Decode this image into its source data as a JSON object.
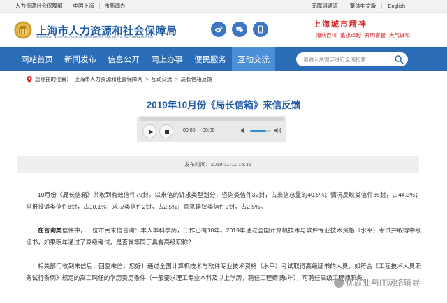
{
  "topbar": {
    "left_links": [
      "人力资源社会保障部",
      "中国上海",
      "市新闻办"
    ],
    "right_links": [
      "无障碍通道",
      "繁体中文版",
      "English"
    ]
  },
  "header": {
    "org_name_cn": "上海市人力资源和社会保障局",
    "org_name_en": "SHANGHAI MUNICIPAL HUMAN RESOURCES AND SOCIAL SECURITY BUREAU",
    "social_icons": [
      "weibo-icon",
      "wechat-icon",
      "mobile-icon"
    ],
    "spirit_title": "上海城市精神",
    "spirit_words": [
      "海纳百川",
      "追求卓越",
      "开明睿智",
      "大气谦和"
    ]
  },
  "nav": {
    "items": [
      "网站首页",
      "新闻发布",
      "信息公开",
      "网上办事",
      "便民服务",
      "互动交流"
    ],
    "active_index": 5,
    "search_placeholder": "请输入关键字进行全网检索"
  },
  "breadcrumb": {
    "prefix": "您现在的位置：",
    "items": [
      "上海市人力资源和社会保障网",
      "互动交流",
      "局长信箱反馈"
    ]
  },
  "article": {
    "title": "2019年10月份《局长信箱》来信反馈",
    "player": {
      "current_time": "00:00",
      "duration": "00:00",
      "volume_level": 0.75
    },
    "publish_label": "发布时间：",
    "publish_date": "2019-11-11 16:35",
    "p1": "10月份《局长信箱》共收到有效信件79封。以来信的诉求类型划分，咨询类信件32封，占来信总量的40.5%；情况反映类信件35封，占44.3%；举报投诉类信件8封，占10.1%；求决类信件2封，占2.5%；意见建议类信件2封，占2.5%。",
    "p2_bold": "在咨询类",
    "p2_rest": "信件中，一位市民来信咨询：本人本科学历，工作已有10年。2019年通过全国计算机技术与软件专业技术资格（水平）考试并取得中级证书，如果明年通过了高级考试，是否就等同于具有高级职称？",
    "p3": "相关部门收到来信后，回复来信：您好！通过全国计算机技术与软件专业技术资格（水平）考试取得高级证书的人员，如符合《工程技术人员职务试行条例》规定的高工聘任的学历资历条件（一般要求理工专业本科及以上学历，聘任工程师满5年），可聘任高级工程师职务。"
  },
  "watermark": {
    "text": "优就业与IT网络辅导"
  },
  "colors": {
    "brand_blue": "#2a6cb6",
    "nav_active": "#4b8fd6",
    "title_blue": "#1f5aa6",
    "spirit_red": "#d4272a"
  }
}
